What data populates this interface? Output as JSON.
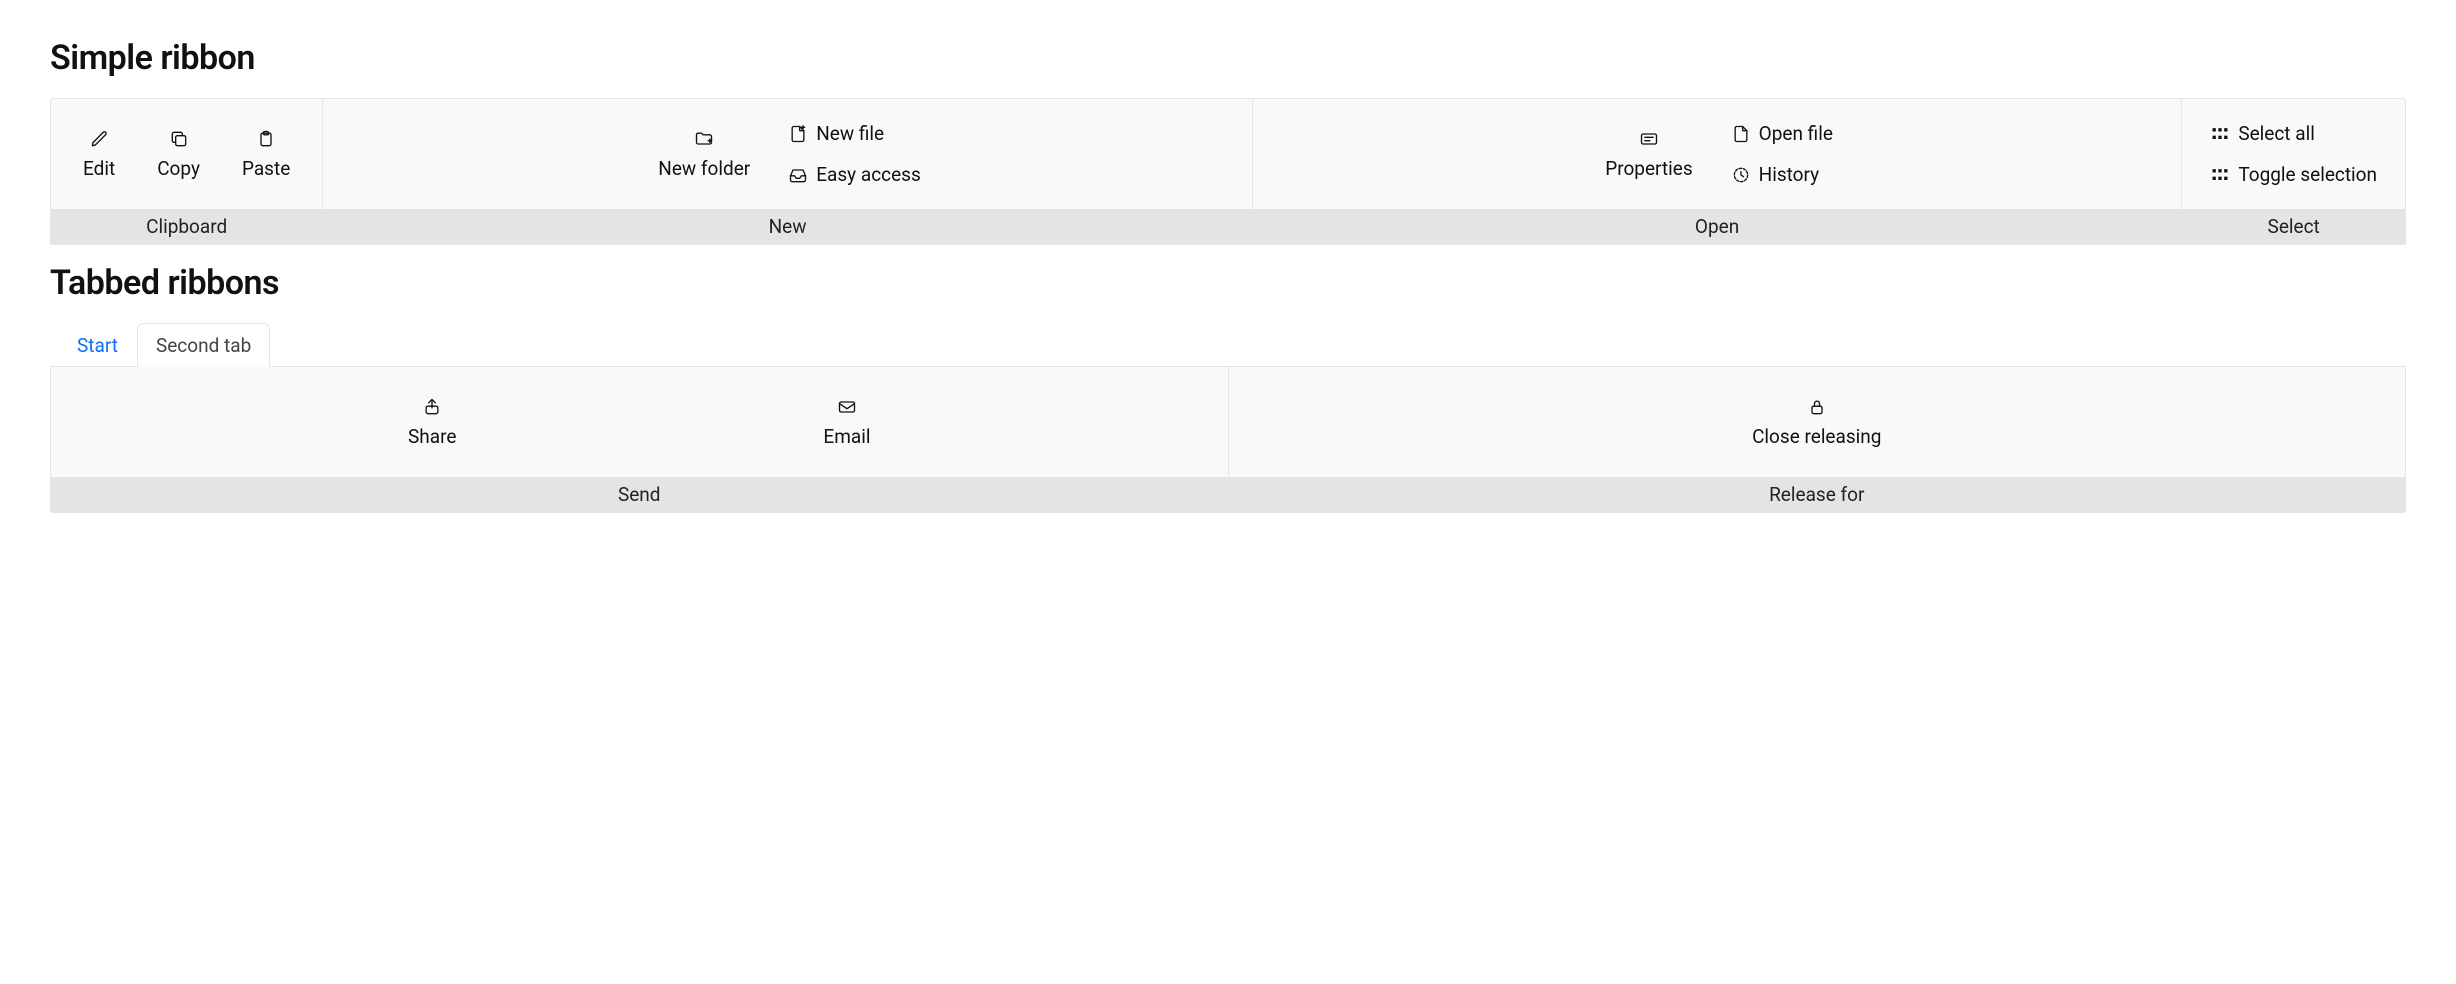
{
  "headings": {
    "simple": "Simple ribbon",
    "tabbed": "Tabbed ribbons"
  },
  "simple": {
    "groups": {
      "clipboard": {
        "label": "Clipboard",
        "items": {
          "edit": "Edit",
          "copy": "Copy",
          "paste": "Paste"
        }
      },
      "new": {
        "label": "New",
        "items": {
          "new_folder": "New folder",
          "new_file": "New file",
          "easy_access": "Easy access"
        }
      },
      "open": {
        "label": "Open",
        "items": {
          "properties": "Properties",
          "open_file": "Open file",
          "history": "History"
        }
      },
      "select": {
        "label": "Select",
        "items": {
          "select_all": "Select all",
          "toggle_selection": "Toggle selection"
        }
      }
    }
  },
  "tabs": {
    "start": "Start",
    "second": "Second tab"
  },
  "tabbed": {
    "groups": {
      "send": {
        "label": "Send",
        "items": {
          "share": "Share",
          "email": "Email"
        }
      },
      "release": {
        "label": "Release for",
        "items": {
          "close_releasing": "Close releasing"
        }
      }
    }
  }
}
